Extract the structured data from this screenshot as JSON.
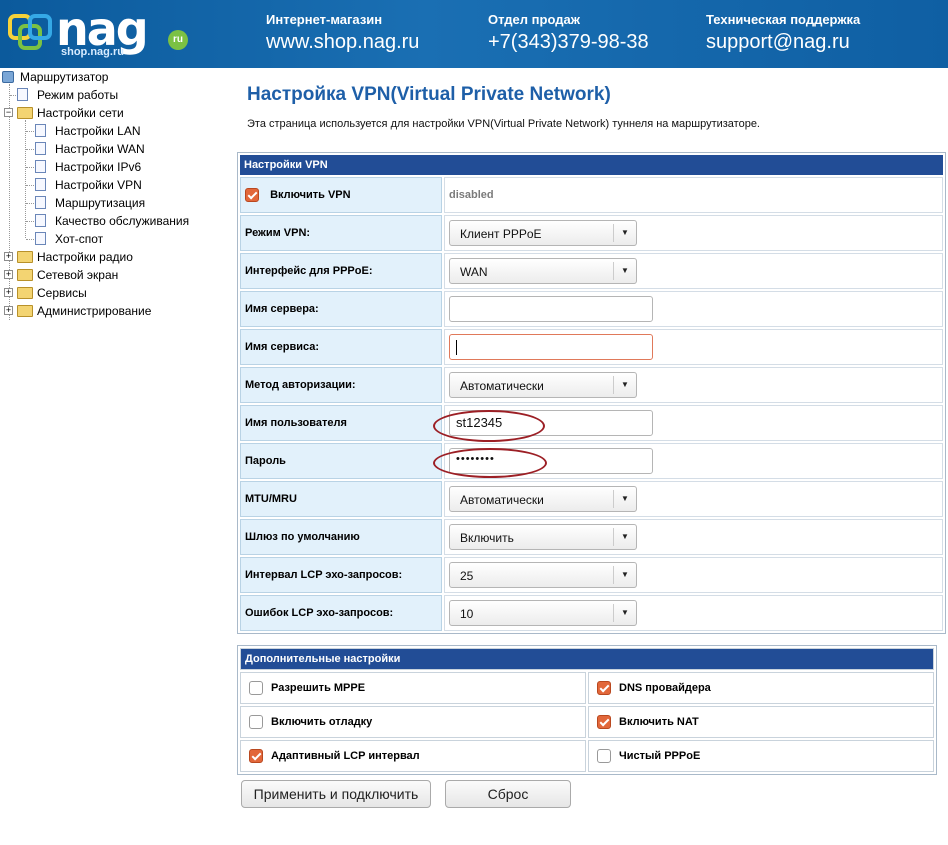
{
  "header": {
    "logo_text": "nag",
    "logo_sub": "shop.nag.ru",
    "logo_ru": "ru",
    "col1": {
      "title": "Интернет-магазин",
      "value": "www.shop.nag.ru"
    },
    "col2": {
      "title": "Отдел продаж",
      "value": "+7(343)379-98-38"
    },
    "col3": {
      "title": "Техническая поддержка",
      "value": "support@nag.ru"
    }
  },
  "sidebar": {
    "root": "Маршрутизатор",
    "items": [
      {
        "label": "Режим работы"
      },
      {
        "label": "Настройки сети"
      },
      {
        "label": "Настройки LAN"
      },
      {
        "label": "Настройки WAN"
      },
      {
        "label": "Настройки IPv6"
      },
      {
        "label": "Настройки VPN"
      },
      {
        "label": "Маршрутизация"
      },
      {
        "label": "Качество обслуживания"
      },
      {
        "label": "Хот-спот"
      },
      {
        "label": "Настройки радио"
      },
      {
        "label": "Сетевой экран"
      },
      {
        "label": "Сервисы"
      },
      {
        "label": "Администрирование"
      }
    ]
  },
  "page": {
    "title": "Настройка VPN(Virtual Private Network)",
    "description": "Эта страница используется для настройки VPN(Virtual Private Network) туннеля на маршрутизаторе."
  },
  "vpn": {
    "section_title": "Настройки VPN",
    "enable_label": "Включить VPN",
    "enable_checked": true,
    "enable_status": "disabled",
    "mode_label": "Режим VPN:",
    "mode_value": "Клиент PPPoE",
    "iface_label": "Интерфейс для PPPoE:",
    "iface_value": "WAN",
    "server_label": "Имя сервера:",
    "server_value": "",
    "service_label": "Имя сервиса:",
    "service_value": "",
    "auth_label": "Метод авторизации:",
    "auth_value": "Автоматически",
    "user_label": "Имя пользователя",
    "user_value": "st12345",
    "pass_label": "Пароль",
    "pass_value": "••••••••",
    "mtu_label": "MTU/MRU",
    "mtu_value": "Автоматически",
    "gw_label": "Шлюз по умолчанию",
    "gw_value": "Включить",
    "lcp_int_label": "Интервал LCP эхо-запросов:",
    "lcp_int_value": "25",
    "lcp_err_label": "Ошибок LCP эхо-запросов:",
    "lcp_err_value": "10"
  },
  "advanced": {
    "section_title": "Дополнительные настройки",
    "options": [
      {
        "label": "Разрешить MPPE",
        "checked": false
      },
      {
        "label": "DNS провайдера",
        "checked": true
      },
      {
        "label": "Включить отладку",
        "checked": false
      },
      {
        "label": "Включить NAT",
        "checked": true
      },
      {
        "label": "Адаптивный LCP интервал",
        "checked": true
      },
      {
        "label": "Чистый PPPoE",
        "checked": false
      }
    ]
  },
  "buttons": {
    "apply": "Применить и подключить",
    "reset": "Сброс"
  }
}
